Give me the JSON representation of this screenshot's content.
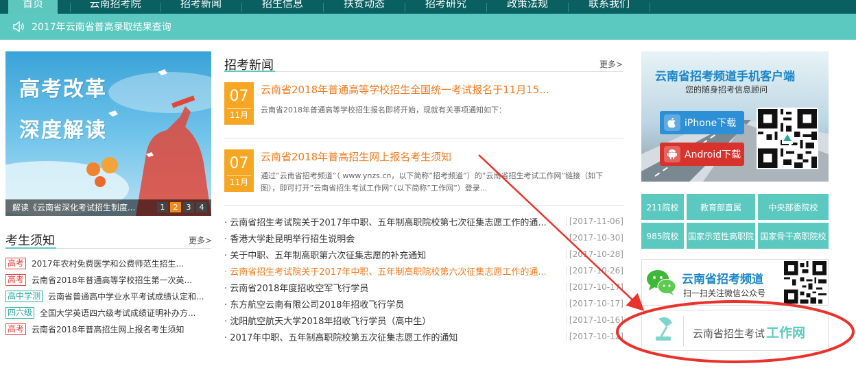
{
  "nav": {
    "items": [
      "首页",
      "云南招考院",
      "招考新闻",
      "招生信息",
      "扶贫动态",
      "招考研究",
      "政策法规",
      "联系我们"
    ]
  },
  "notice": {
    "text": "2017年云南省普高录取结果查询"
  },
  "slider": {
    "headline1": "高考改革",
    "headline2": "深度解读",
    "caption": "解读《云南省深化考试招生制度...",
    "pages": [
      "1",
      "2",
      "3",
      "4"
    ],
    "active_page": "2"
  },
  "kaosheng": {
    "title": "考生须知",
    "more": "更多>",
    "items": [
      {
        "tag": "高考",
        "tag_color": "red",
        "text": "2017年农村免费医学和公费师范生招生..."
      },
      {
        "tag": "高考",
        "tag_color": "red",
        "text": "云南省2018年普通高等学校招生第一次英..."
      },
      {
        "tag": "高中学测",
        "tag_color": "teal",
        "text": "云南省普通高中学业水平考试成绩认定和..."
      },
      {
        "tag": "四六级",
        "tag_color": "teal",
        "text": "全国大学英语四六级考试成绩证明补办方..."
      },
      {
        "tag": "高考",
        "tag_color": "red",
        "text": "云南省2018年普高招生网上报名考生须知"
      }
    ]
  },
  "news": {
    "title": "招考新闻",
    "more": "更多>",
    "featured": [
      {
        "day": "07",
        "month": "11月",
        "title": "云南省2018年普通高等学校招生全国统一考试报名于11月15...",
        "desc": "云南省2018年普通高等学校招生报名即将开始，现就有关事项通知如下："
      },
      {
        "day": "07",
        "month": "11月",
        "title": "云南省2018年普高招生网上报名考生须知",
        "desc": "通过”云南省招考频道”（ www.ynzs.cn，以下简称”招考频道”）的”云南省招生考试工作网”链接（如下图），即可打开”云南省招生考试工作网”（以下简称”工作网”）登录..."
      }
    ],
    "list": [
      {
        "text": "· 云南省招生考试院关于2017年中职、五年制高职院校第七次征集志愿工作的通...",
        "date": "[2017-11-06]",
        "hot": false
      },
      {
        "text": "· 香港大学赴昆明举行招生说明会",
        "date": "[2017-10-30]",
        "hot": false
      },
      {
        "text": "· 关于中职、五年制高职第六次征集志愿的补充通知",
        "date": "[2017-10-28]",
        "hot": false
      },
      {
        "text": "· 云南省招生考试院关于2017年中职、五年制高职院校第六次征集志愿工作的通...",
        "date": "[2017-10-26]",
        "hot": true
      },
      {
        "text": "· 云南省2018年度招收空军飞行学员",
        "date": "[2017-10-17]",
        "hot": false
      },
      {
        "text": "· 东方航空云南有限公司2018年招收飞行学员",
        "date": "[2017-10-17]",
        "hot": false
      },
      {
        "text": "· 沈阳航空航天大学2018年招收飞行学员（高中生）",
        "date": "[2017-10-16]",
        "hot": false
      },
      {
        "text": "· 2017年中职、五年制高职院校第五次征集志愿工作的通知",
        "date": "[2017-10-12]",
        "hot": false
      }
    ]
  },
  "app": {
    "title": "云南省招考频道手机客户端",
    "subtitle": "您的随身招考信息顾问",
    "iphone": "iPhone下载",
    "android": "Android下载"
  },
  "categories": [
    "211院校",
    "教育部直属",
    "中央部委院校",
    "985院校",
    "国家示范性高职院",
    "国家骨干高职院校"
  ],
  "wechat": {
    "title": "云南省招考频道",
    "subtitle": "扫一扫关注微信公众号"
  },
  "workweb": {
    "text": "云南省招生考试",
    "highlight": "工作网"
  },
  "colors": {
    "teal": "#5cc9c0",
    "dark_teal": "#0a5f60",
    "orange": "#f5a623",
    "red": "#e2403c",
    "annotation_red": "#e8322b"
  }
}
